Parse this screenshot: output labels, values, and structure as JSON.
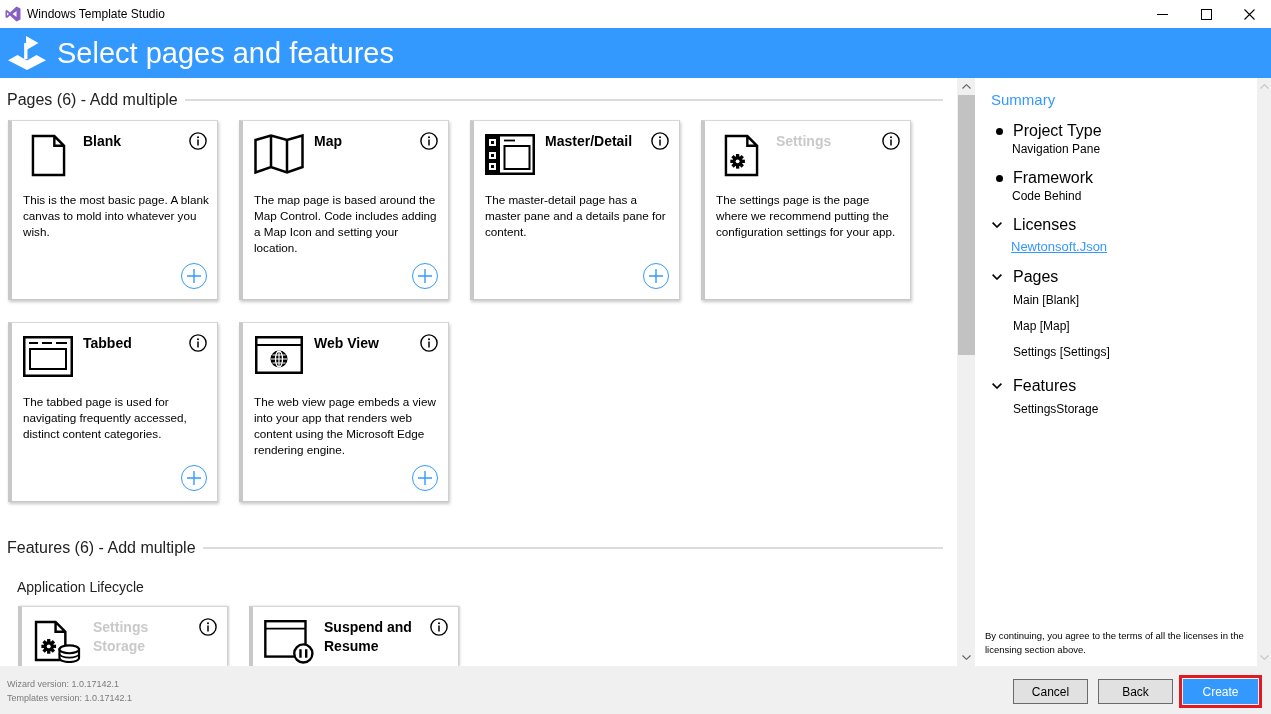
{
  "window": {
    "title": "Windows Template Studio"
  },
  "header": {
    "title": "Select pages and features"
  },
  "pages": {
    "title": "Pages (6) - Add multiple",
    "cards": [
      {
        "kind": "blank",
        "title": "Blank",
        "description": "This is the most basic page. A blank canvas to mold into whatever you wish.",
        "disabled": false
      },
      {
        "kind": "map",
        "title": "Map",
        "description": "The map page is based around the Map Control. Code includes adding a Map Icon and setting your location.",
        "disabled": false
      },
      {
        "kind": "master-detail",
        "title": "Master/Detail",
        "description": "The master-detail page has a master pane and a details pane for content.",
        "disabled": false
      },
      {
        "kind": "settings",
        "title": "Settings",
        "description": "The settings page is the page where we recommend putting the configuration settings for your app.",
        "disabled": true
      },
      {
        "kind": "tabbed",
        "title": "Tabbed",
        "description": "The tabbed page is used for navigating frequently accessed, distinct content categories.",
        "disabled": false
      },
      {
        "kind": "web-view",
        "title": "Web View",
        "description": "The web view page embeds a view into your app that renders web content using the Microsoft Edge rendering engine.",
        "disabled": false
      }
    ]
  },
  "features": {
    "title": "Features (6) - Add multiple",
    "groups": [
      {
        "title": "Application Lifecycle",
        "cards": [
          {
            "kind": "settings-storage",
            "title": "Settings Storage",
            "disabled": true
          },
          {
            "kind": "suspend-resume",
            "title": "Suspend and Resume",
            "disabled": false
          }
        ]
      }
    ]
  },
  "summary": {
    "title": "Summary",
    "sections": [
      {
        "kind": "bullet",
        "title": "Project Type",
        "value": "Navigation Pane"
      },
      {
        "kind": "bullet",
        "title": "Framework",
        "value": "Code Behind"
      },
      {
        "kind": "group",
        "title": "Licenses",
        "expanded": true,
        "items": [
          {
            "kind": "link",
            "text": "Newtonsoft.Json"
          }
        ]
      },
      {
        "kind": "group",
        "title": "Pages",
        "expanded": true,
        "items": [
          {
            "kind": "text",
            "text": "Main [Blank]"
          },
          {
            "kind": "text",
            "text": "Map [Map]"
          },
          {
            "kind": "text",
            "text": "Settings [Settings]"
          }
        ]
      },
      {
        "kind": "group",
        "title": "Features",
        "expanded": true,
        "items": [
          {
            "kind": "text",
            "text": "SettingsStorage"
          }
        ]
      }
    ],
    "note": "By continuing, you agree to the terms of all the licenses in the licensing section above."
  },
  "footer": {
    "versions": [
      "Wizard version: 1.0.17142.1",
      "Templates version: 1.0.17142.1"
    ],
    "buttons": [
      {
        "label": "Cancel",
        "kind": "default",
        "highlighted": false
      },
      {
        "label": "Back",
        "kind": "default",
        "highlighted": false
      },
      {
        "label": "Create",
        "kind": "primary",
        "highlighted": true
      }
    ]
  }
}
